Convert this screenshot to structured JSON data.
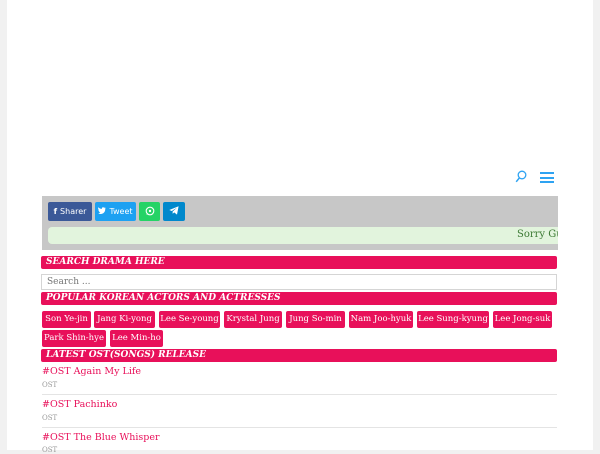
{
  "header": {
    "search_icon": "search-icon",
    "menu_icon": "hamburger-menu-icon"
  },
  "share": {
    "facebook_label": "Sharer",
    "twitter_label": "Tweet",
    "whatsapp_icon": "whatsapp-icon",
    "telegram_icon": "telegram-icon"
  },
  "marquee": {
    "text": "Sorry Gu"
  },
  "search_section": {
    "title": "SEARCH DRAMA HERE",
    "placeholder": "Search ..."
  },
  "actors_section": {
    "title": "POPULAR KOREAN ACTORS AND ACTRESSES",
    "actors": [
      "Son Ye-jin",
      "Jang Ki-yong",
      "Lee Se-young",
      "Krystal Jung",
      "Jung So-min",
      "Nam Joo-hyuk",
      "Lee Sung-kyung",
      "Lee Jong-suk",
      "Park Shin-hye",
      "Lee Min-ho"
    ]
  },
  "ost_section": {
    "title": "LATEST OST(SONGS) RELEASE",
    "items": [
      {
        "title": "#OST Again My Life",
        "category": "OST"
      },
      {
        "title": "#OST Pachinko",
        "category": "OST"
      },
      {
        "title": "#OST The Blue Whisper",
        "category": "OST"
      }
    ]
  },
  "colors": {
    "accent": "#e8105a",
    "link_blue": "#2ea3f2",
    "facebook": "#3b5998",
    "twitter": "#1da1f2",
    "whatsapp": "#25d366",
    "telegram": "#0088cc"
  }
}
